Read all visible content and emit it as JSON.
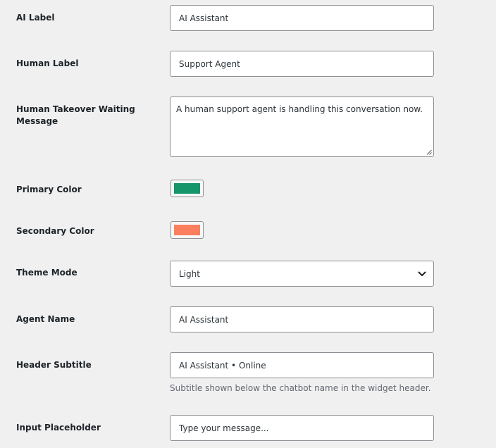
{
  "fields": {
    "ai_label": {
      "label": "AI Label",
      "value": "AI Assistant"
    },
    "human_label": {
      "label": "Human Label",
      "value": "Support Agent"
    },
    "takeover_message": {
      "label_line1": "Human Takeover Waiting",
      "label_line2": "Message",
      "value": "A human support agent is handling this conversation now."
    },
    "primary_color": {
      "label": "Primary Color",
      "value": "#14956a"
    },
    "secondary_color": {
      "label": "Secondary Color",
      "value": "#fb7f5e"
    },
    "theme_mode": {
      "label": "Theme Mode",
      "selected": "Light"
    },
    "agent_name": {
      "label": "Agent Name",
      "value": "AI Assistant"
    },
    "header_subtitle": {
      "label": "Header Subtitle",
      "value": "AI Assistant • Online",
      "help": "Subtitle shown below the chatbot name in the widget header."
    },
    "input_placeholder": {
      "label": "Input Placeholder",
      "value": "Type your message..."
    }
  },
  "icons": {
    "select_arrow": "chevron-down-icon",
    "resize": "resize-handle-icon"
  }
}
